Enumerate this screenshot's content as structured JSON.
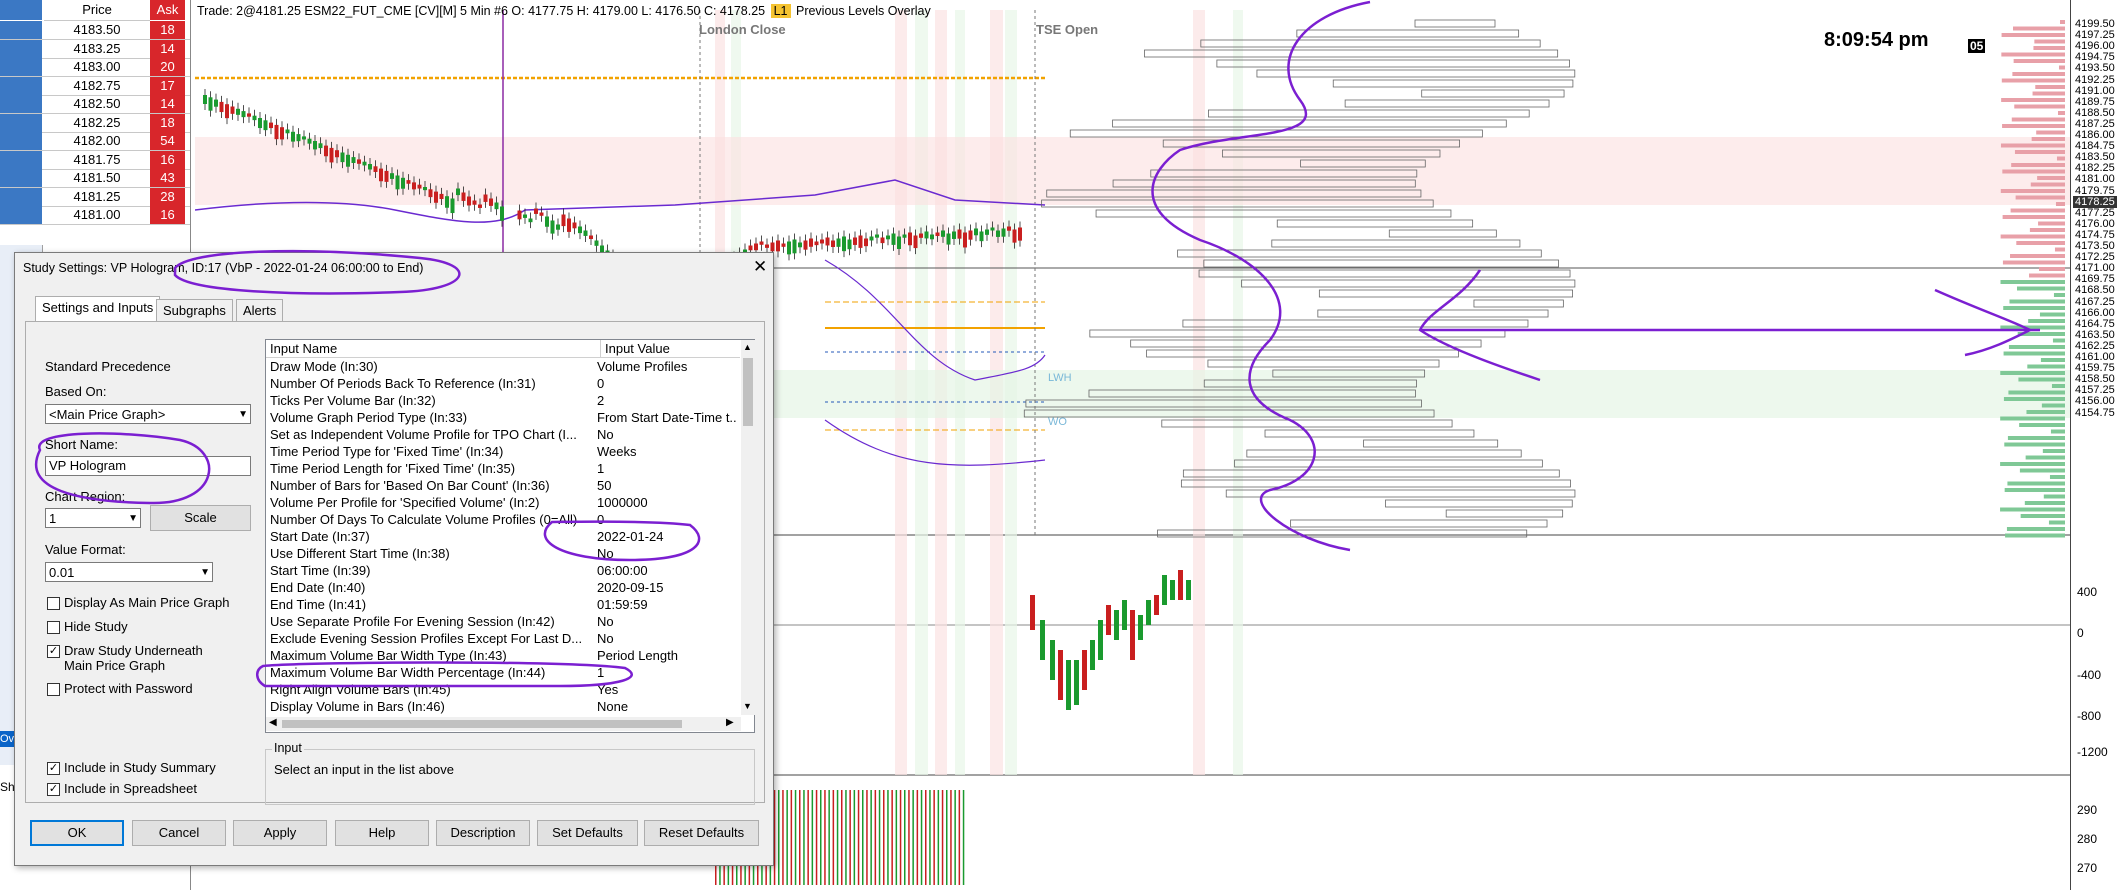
{
  "ladder": {
    "header_price": "Price",
    "header_ask": "Ask",
    "rows": [
      {
        "price": "4183.50",
        "ask": "18"
      },
      {
        "price": "4183.25",
        "ask": "14"
      },
      {
        "price": "4183.00",
        "ask": "20"
      },
      {
        "price": "4182.75",
        "ask": "17"
      },
      {
        "price": "4182.50",
        "ask": "14"
      },
      {
        "price": "4182.25",
        "ask": "18"
      },
      {
        "price": "4182.00",
        "ask": "54"
      },
      {
        "price": "4181.75",
        "ask": "16"
      },
      {
        "price": "4181.50",
        "ask": "43"
      },
      {
        "price": "4181.25",
        "ask": "28"
      },
      {
        "price": "4181.00",
        "ask": "16"
      }
    ]
  },
  "chart": {
    "title_prefix": "Trade: 2@4181.25 ESM22_FUT_CME [CV][M]  5 Min  #6 O: 4177.75 H: 4179.00 L: 4176.50 C: 4178.25",
    "title_badge": "L1",
    "title_suffix": "Previous Levels Overlay",
    "clock": "8:09:54 pm",
    "clock_badge": "05",
    "labels": {
      "london_close": "London Close",
      "tse_open": "TSE Open",
      "lwh": "LWH",
      "wo": "WO"
    },
    "price_axis": [
      "4199.50",
      "4197.25",
      "4196.00",
      "4194.75",
      "4193.50",
      "4192.25",
      "4191.00",
      "4189.75",
      "4188.50",
      "4187.25",
      "4186.00",
      "4184.75",
      "4183.50",
      "4182.25",
      "4181.00",
      "4179.75",
      "4178.25",
      "4177.25",
      "4176.00",
      "4174.75",
      "4173.50",
      "4172.25",
      "4171.00",
      "4169.75",
      "4168.50",
      "4167.25",
      "4166.00",
      "4164.75",
      "4163.50",
      "4162.25",
      "4161.00",
      "4159.75",
      "4158.50",
      "4157.25",
      "4156.00",
      "4154.75"
    ],
    "current_price": "4178.25",
    "osc_axis": [
      "400",
      "0",
      "-400",
      "-800",
      "-1200"
    ],
    "vol_axis": [
      "290",
      "280",
      "270"
    ]
  },
  "dialog": {
    "title": "Study Settings: VP Hologram, ID:17 (VbP - 2022-01-24  06:00:00 to End)",
    "tabs": [
      "Settings and Inputs",
      "Subgraphs",
      "Alerts"
    ],
    "standard_precedence": "Standard Precedence",
    "based_on_label": "Based On:",
    "based_on_value": "<Main Price Graph>",
    "short_name_label": "Short Name:",
    "short_name_value": "VP Hologram",
    "chart_region_label": "Chart Region:",
    "chart_region_value": "1",
    "scale_button": "Scale",
    "value_format_label": "Value Format:",
    "value_format_value": "0.01",
    "checks": [
      {
        "label": "Display As Main Price Graph",
        "checked": false
      },
      {
        "label": "Hide Study",
        "checked": false
      },
      {
        "label": "Draw Study Underneath\nMain Price Graph",
        "checked": true
      },
      {
        "label": "Protect with Password",
        "checked": false
      }
    ],
    "include_summary": "Include in Study Summary",
    "include_spreadsheet": "Include in Spreadsheet",
    "grid_header_name": "Input Name",
    "grid_header_value": "Input Value",
    "inputs": [
      {
        "name": "Draw Mode  (In:30)",
        "value": "Volume Profiles"
      },
      {
        "name": "Number Of Periods Back To Reference  (In:31)",
        "value": "0"
      },
      {
        "name": "Ticks Per Volume Bar  (In:32)",
        "value": "2"
      },
      {
        "name": "Volume Graph Period Type  (In:33)",
        "value": "From Start Date-Time t..."
      },
      {
        "name": "Set as Independent Volume Profile for TPO Chart  (I...",
        "value": "No"
      },
      {
        "name": "Time Period Type for 'Fixed Time'  (In:34)",
        "value": "Weeks"
      },
      {
        "name": "Time Period Length for 'Fixed Time'  (In:35)",
        "value": "1"
      },
      {
        "name": "Number of Bars for 'Based On Bar Count'  (In:36)",
        "value": "50"
      },
      {
        "name": "Volume Per Profile for 'Specified Volume'  (In:2)",
        "value": "1000000"
      },
      {
        "name": "Number Of Days To Calculate Volume Profiles (0=All)",
        "value": "0"
      },
      {
        "name": "Start Date  (In:37)",
        "value": "2022-01-24"
      },
      {
        "name": "Use Different Start Time  (In:38)",
        "value": "No"
      },
      {
        "name": "Start Time  (In:39)",
        "value": "06:00:00"
      },
      {
        "name": "End Date  (In:40)",
        "value": "2020-09-15"
      },
      {
        "name": "End Time  (In:41)",
        "value": "01:59:59"
      },
      {
        "name": "Use Separate Profile For Evening Session  (In:42)",
        "value": "No"
      },
      {
        "name": "Exclude Evening Session Profiles Except For Last D...",
        "value": "No"
      },
      {
        "name": "Maximum Volume Bar Width Type  (In:43)",
        "value": "Period Length"
      },
      {
        "name": "Maximum Volume Bar Width Percentage  (In:44)",
        "value": "1"
      },
      {
        "name": "Right Align Volume Bars  (In:45)",
        "value": "Yes"
      },
      {
        "name": "Display Volume in Bars  (In:46)",
        "value": "None"
      }
    ],
    "input_group_label": "Input",
    "input_hint": "Select an input in the list above",
    "buttons": [
      "OK",
      "Cancel",
      "Apply",
      "Help",
      "Description",
      "Set Defaults",
      "Reset Defaults"
    ]
  },
  "left_edge": {
    "stub_text": "Ov",
    "bottom_text": "Sh"
  }
}
